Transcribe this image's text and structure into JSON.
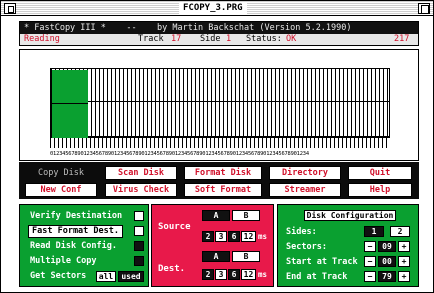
{
  "window": {
    "title": "FCOPY_3.PRG"
  },
  "banner": {
    "line": "* FastCopy III *    --    by Martin Backschat (Version 5.2.1990)",
    "status_label": "Reading",
    "track_label": "Track",
    "track_value": "17",
    "side_label": "Side",
    "side_value": "1",
    "status_word": "Status:",
    "status_value": "OK",
    "counter": "217"
  },
  "track_panel": {
    "progress_tracks_done": 9,
    "progress_tracks_total": 85,
    "numbers": "0123456789012345678901234567890123456789012345678901234567890123456789012345678901234"
  },
  "menu": {
    "row1": [
      "Copy Disk",
      "Scan Disk",
      "Format Disk",
      "Directory",
      "Quit"
    ],
    "row2": [
      "New Conf",
      "Virus Check",
      "Soft Format",
      "Streamer",
      "Help"
    ]
  },
  "options": {
    "verify": "Verify Destination",
    "fast_format": "Fast Format Dest.",
    "read_config": "Read Disk Config.",
    "multiple": "Multiple Copy",
    "get_sectors": "Get Sectors",
    "get_sectors_all": "all",
    "get_sectors_used": "used"
  },
  "drives": {
    "source_label": "Source",
    "dest_label": "Dest.",
    "source_a": "A",
    "source_b": "B",
    "dest_a": "A",
    "dest_b": "B",
    "source_nums": [
      "2",
      "3",
      "6",
      "12"
    ],
    "dest_nums": [
      "2",
      "3",
      "6",
      "12"
    ],
    "unit": "ms"
  },
  "disk_config": {
    "title": "Disk Configuration",
    "sides_label": "Sides:",
    "sides_1": "1",
    "sides_2": "2",
    "sectors_label": "Sectors:",
    "sectors_value": "09",
    "start_label": "Start at Track",
    "start_value": "00",
    "end_label": "End at Track",
    "end_value": "79",
    "minus": "−",
    "plus": "+"
  },
  "colors": {
    "accent_red": "#d0102a",
    "panel_green": "#0aa030",
    "panel_pink": "#e8194a"
  }
}
